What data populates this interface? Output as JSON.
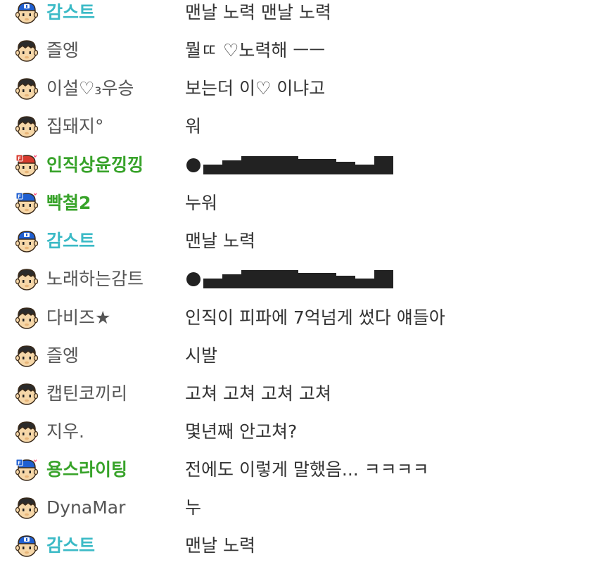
{
  "messages": [
    {
      "nick": "감스트",
      "text": "맨날 노력 맨날 노력",
      "nick_style": "cyan",
      "avatar": "blue-cap-avatar-icon"
    },
    {
      "nick": "즐엥",
      "text": "뭘ㄸ ♡노력해 ㅡㅡ",
      "nick_style": "gray",
      "avatar": "default-avatar-icon"
    },
    {
      "nick": "이설♡₃우승",
      "text": "보는더 이♡ 이냐고",
      "nick_style": "gray",
      "avatar": "default-avatar-icon"
    },
    {
      "nick": "집돼지°",
      "text": "워",
      "nick_style": "gray",
      "avatar": "default-avatar-icon"
    },
    {
      "nick": "인직상윤낑낑",
      "text": "",
      "nick_style": "green",
      "avatar": "fan-red-cap-avatar-icon",
      "censored": true
    },
    {
      "nick": "빡철2",
      "text": "누워",
      "nick_style": "green",
      "avatar": "fan-blue-cap-avatar-icon"
    },
    {
      "nick": "감스트",
      "text": "맨날 노력",
      "nick_style": "cyan",
      "avatar": "blue-cap-avatar-icon"
    },
    {
      "nick": "노래하는감트",
      "text": "",
      "nick_style": "gray",
      "avatar": "default-avatar-icon",
      "censored": true
    },
    {
      "nick": "다비즈★",
      "text": "인직이 피파에 7억넘게 썼다 얘들아",
      "nick_style": "gray",
      "avatar": "default-avatar-icon"
    },
    {
      "nick": "즐엥",
      "text": "시발",
      "nick_style": "gray",
      "avatar": "default-avatar-icon"
    },
    {
      "nick": "캡틴코끼리",
      "text": "고쳐 고쳐 고쳐 고쳐",
      "nick_style": "gray",
      "avatar": "default-avatar-icon"
    },
    {
      "nick": "지우.",
      "text": "몇년째 안고쳐?",
      "nick_style": "gray",
      "avatar": "default-avatar-icon"
    },
    {
      "nick": "용스라이팅",
      "text": "전에도 이렇게 말했음... ㅋㅋㅋㅋ",
      "nick_style": "green",
      "avatar": "fan-blue-cap-avatar-icon"
    },
    {
      "nick": "DynaMar",
      "text": "누",
      "nick_style": "gray",
      "avatar": "default-avatar-icon"
    },
    {
      "nick": "감스트",
      "text": "맨날 노력",
      "nick_style": "cyan",
      "avatar": "blue-cap-avatar-icon"
    }
  ],
  "colors": {
    "streamer_nick": "#3bbac6",
    "fan_nick": "#38a32a",
    "viewer_nick": "#555555",
    "message_text": "#333333",
    "censor_bar": "#222222"
  }
}
